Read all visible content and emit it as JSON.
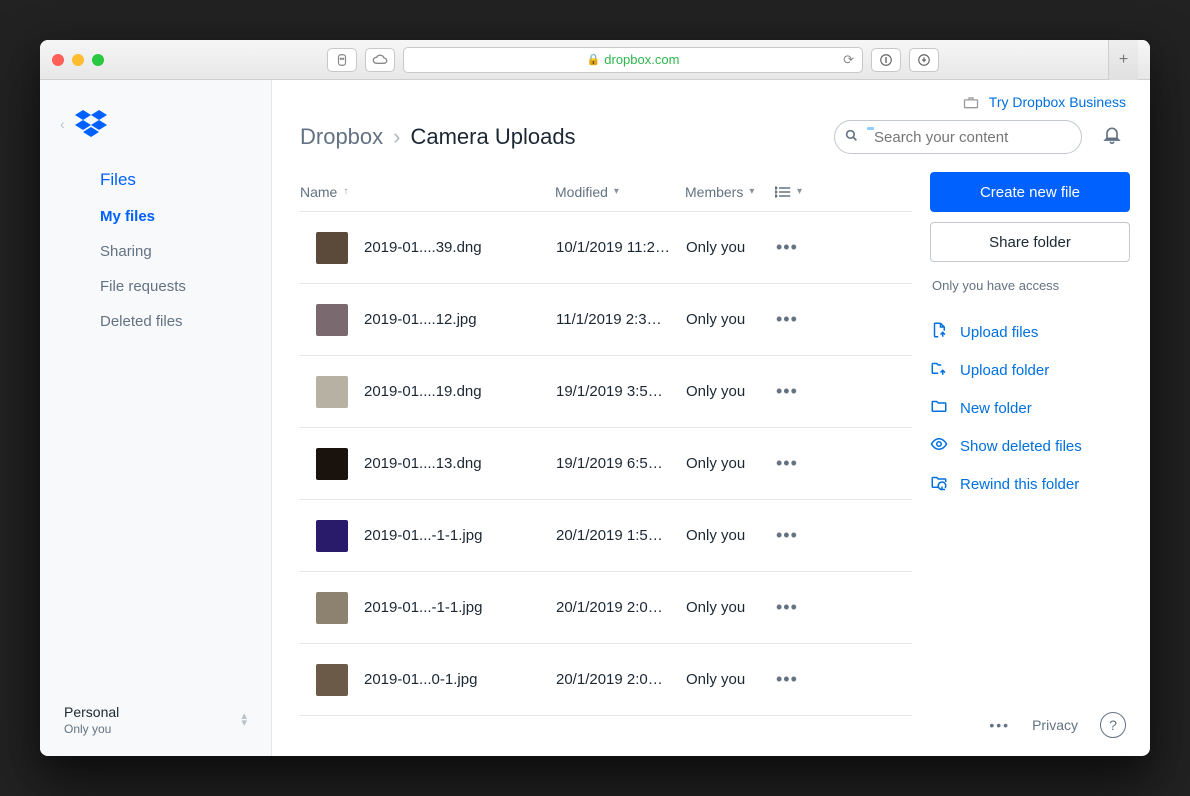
{
  "browser": {
    "url_host": "dropbox.com"
  },
  "promo": {
    "label": "Try Dropbox Business"
  },
  "sidebar": {
    "section": "Files",
    "items": [
      {
        "label": "My files",
        "active": true
      },
      {
        "label": "Sharing",
        "active": false
      },
      {
        "label": "File requests",
        "active": false
      },
      {
        "label": "Deleted files",
        "active": false
      }
    ],
    "footer": {
      "line1": "Personal",
      "line2": "Only you"
    }
  },
  "breadcrumb": {
    "root": "Dropbox",
    "current": "Camera Uploads"
  },
  "search": {
    "placeholder": "Search your content"
  },
  "columns": {
    "name": "Name",
    "modified": "Modified",
    "members": "Members"
  },
  "files": [
    {
      "name": "2019-01....39.dng",
      "modified": "10/1/2019 11:2…",
      "members": "Only you",
      "thumb": "#5b4a3a"
    },
    {
      "name": "2019-01....12.jpg",
      "modified": "11/1/2019 2:3…",
      "members": "Only you",
      "thumb": "#7a6a70"
    },
    {
      "name": "2019-01....19.dng",
      "modified": "19/1/2019 3:5…",
      "members": "Only you",
      "thumb": "#b7b1a3"
    },
    {
      "name": "2019-01....13.dng",
      "modified": "19/1/2019 6:5…",
      "members": "Only you",
      "thumb": "#1a120d"
    },
    {
      "name": "2019-01...-1-1.jpg",
      "modified": "20/1/2019 1:5…",
      "members": "Only you",
      "thumb": "#2a1a6a"
    },
    {
      "name": "2019-01...-1-1.jpg",
      "modified": "20/1/2019 2:0…",
      "members": "Only you",
      "thumb": "#8d8270"
    },
    {
      "name": "2019-01...0-1.jpg",
      "modified": "20/1/2019 2:0…",
      "members": "Only you",
      "thumb": "#6b5a48"
    }
  ],
  "right": {
    "create": "Create new file",
    "share": "Share folder",
    "access_note": "Only you have access",
    "actions": [
      {
        "label": "Upload files",
        "icon": "upload-file"
      },
      {
        "label": "Upload folder",
        "icon": "upload-folder"
      },
      {
        "label": "New folder",
        "icon": "new-folder"
      },
      {
        "label": "Show deleted files",
        "icon": "eye"
      },
      {
        "label": "Rewind this folder",
        "icon": "rewind"
      }
    ]
  },
  "footer": {
    "privacy": "Privacy"
  }
}
